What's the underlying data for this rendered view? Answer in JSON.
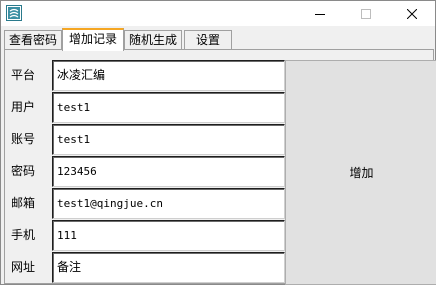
{
  "window": {
    "app_icon": "document-list-icon",
    "controls": [
      "minimize-icon",
      "maximize-icon",
      "close-icon"
    ]
  },
  "tabs": [
    {
      "label": "查看密码",
      "active": false
    },
    {
      "label": "增加记录",
      "active": true
    },
    {
      "label": "随机生成",
      "active": false
    },
    {
      "label": "设置",
      "active": false
    }
  ],
  "form": {
    "rows": [
      {
        "label": "平台",
        "value": "冰凌汇编"
      },
      {
        "label": "用户",
        "value": "test1"
      },
      {
        "label": "账号",
        "value": "test1"
      },
      {
        "label": "密码",
        "value": "123456"
      },
      {
        "label": "邮箱",
        "value": "test1@qingjue.cn"
      },
      {
        "label": "手机",
        "value": "111"
      },
      {
        "label": "网址",
        "value": "备注"
      }
    ],
    "add_button_label": "增加"
  }
}
